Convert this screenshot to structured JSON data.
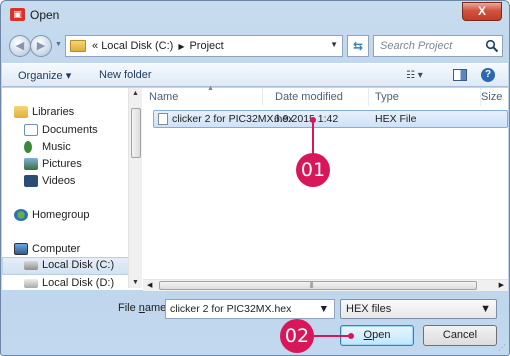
{
  "window": {
    "title": "Open",
    "close_label": "X"
  },
  "address": {
    "crumb_prefix": "«",
    "crumbs": [
      "Local Disk (C:)",
      "Project"
    ],
    "search_placeholder": "Search Project"
  },
  "toolbar": {
    "organize": "Organize ▾",
    "new_folder": "New folder"
  },
  "nav": {
    "libraries": "Libraries",
    "documents": "Documents",
    "music": "Music",
    "pictures": "Pictures",
    "videos": "Videos",
    "homegroup": "Homegroup",
    "computer": "Computer",
    "disk_c": "Local Disk (C:)",
    "disk_d": "Local Disk (D:)"
  },
  "columns": {
    "name": "Name",
    "date": "Date modified",
    "type": "Type",
    "size": "Size"
  },
  "files": [
    {
      "name": "clicker 2 for PIC32MX.hex",
      "date": "6.9.2015 1:42",
      "type": "HEX File"
    }
  ],
  "bottom": {
    "filename_label_pre": "File ",
    "filename_label_u": "n",
    "filename_label_post": "ame:",
    "filename_value": "clicker 2 for PIC32MX.hex",
    "filetype": "HEX files",
    "open_label_u": "O",
    "open_label_rest": "pen",
    "cancel_label": "Cancel"
  },
  "callouts": {
    "first": "01",
    "second": "02"
  },
  "colors": {
    "callout": "#d8175a",
    "selection": "#cfe2f8"
  }
}
